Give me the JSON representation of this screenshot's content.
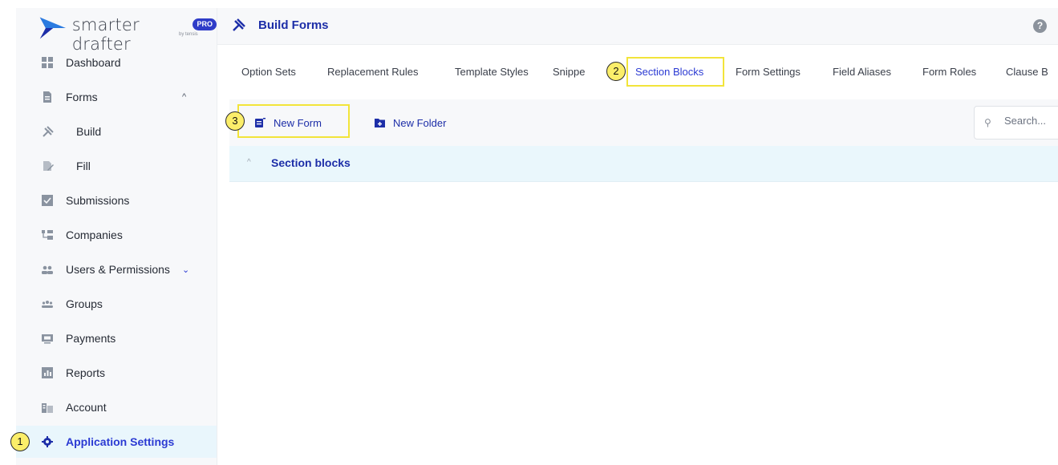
{
  "app": {
    "logo_text": "smarter drafter",
    "logo_badge": "PRO",
    "logo_sub": "by tensis"
  },
  "sidebar": {
    "items": [
      {
        "label": "Dashboard",
        "icon": "dashboard-icon"
      },
      {
        "label": "Forms",
        "icon": "document-icon",
        "chevron": "^"
      },
      {
        "label": "Build",
        "icon": "tools-icon"
      },
      {
        "label": "Fill",
        "icon": "fill-icon"
      },
      {
        "label": "Submissions",
        "icon": "submissions-icon"
      },
      {
        "label": "Companies",
        "icon": "companies-icon"
      },
      {
        "label": "Users & Permissions",
        "icon": "users-icon",
        "chevron": "⌄"
      },
      {
        "label": "Groups",
        "icon": "groups-icon"
      },
      {
        "label": "Payments",
        "icon": "payments-icon"
      },
      {
        "label": "Reports",
        "icon": "reports-icon"
      },
      {
        "label": "Account",
        "icon": "account-icon"
      },
      {
        "label": "Application Settings",
        "icon": "gear-icon"
      }
    ]
  },
  "header": {
    "title": "Build Forms",
    "help": "?"
  },
  "tabs": [
    {
      "label": "Option Sets"
    },
    {
      "label": "Replacement Rules"
    },
    {
      "label": "Template Styles"
    },
    {
      "label": "Snippe"
    },
    {
      "label": "Section Blocks"
    },
    {
      "label": "Form Settings"
    },
    {
      "label": "Field Aliases"
    },
    {
      "label": "Form Roles"
    },
    {
      "label": "Clause B"
    }
  ],
  "toolbar": {
    "new_form": "New Form",
    "new_folder": "New Folder",
    "search_placeholder": "Search..."
  },
  "section": {
    "title": "Section blocks",
    "caret": "^"
  },
  "callouts": [
    "1",
    "2",
    "3"
  ],
  "colors": {
    "accent": "#2b3ad3",
    "highlight": "#f2e43a",
    "active_bg": "#e9f6fc"
  }
}
